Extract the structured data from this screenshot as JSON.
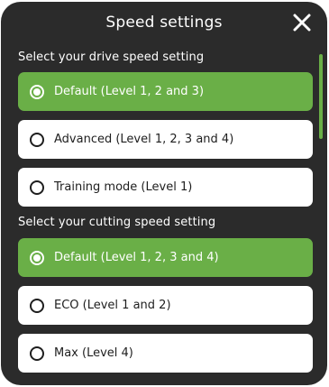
{
  "dialog": {
    "title": "Speed settings",
    "close_icon": "close-icon"
  },
  "drive": {
    "label": "Select your drive speed setting",
    "options": [
      {
        "label": "Default (Level 1, 2 and 3)",
        "selected": true
      },
      {
        "label": "Advanced  (Level 1, 2, 3 and 4)",
        "selected": false
      },
      {
        "label": "Training mode (Level 1)",
        "selected": false
      }
    ]
  },
  "cutting": {
    "label": "Select your cutting speed setting",
    "options": [
      {
        "label": "Default (Level 1, 2, 3 and 4)",
        "selected": true
      },
      {
        "label": "ECO  (Level 1 and 2)",
        "selected": false
      },
      {
        "label": "Max (Level 4)",
        "selected": false
      }
    ]
  },
  "colors": {
    "panel_background": "#2b2b2b",
    "accent": "#6aaf47",
    "option_background": "#ffffff",
    "text_dark": "#1e1e1e",
    "text_light": "#ffffff"
  }
}
